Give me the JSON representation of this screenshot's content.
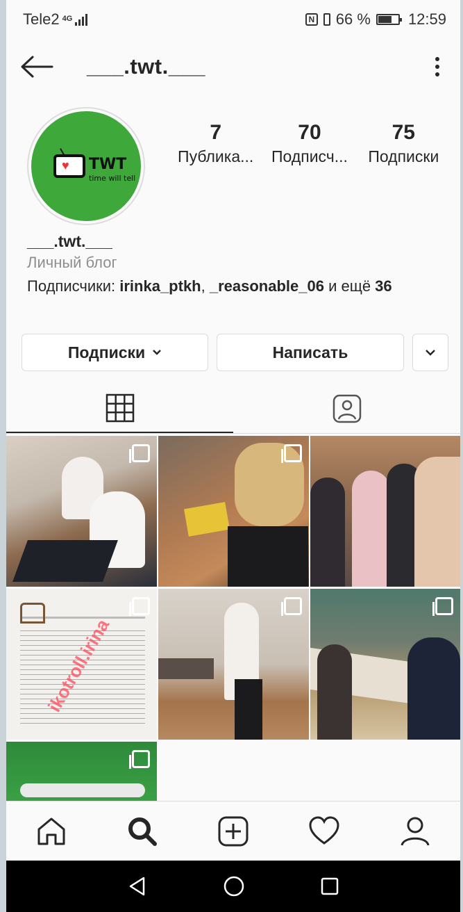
{
  "status": {
    "carrier": "Tele2",
    "network": "4G",
    "battery": "66 %",
    "time": "12:59"
  },
  "header": {
    "username": "___.twt.___"
  },
  "avatar": {
    "logo_text": "TWT",
    "logo_tagline": "time will tell"
  },
  "stats": [
    {
      "num": "7",
      "label": "Публика..."
    },
    {
      "num": "70",
      "label": "Подписч..."
    },
    {
      "num": "75",
      "label": "Подписки"
    }
  ],
  "bio": {
    "name": "___.twt.___",
    "category": "Личный блог",
    "followed_prefix": "Подписчики: ",
    "user1": "irinka_ptkh",
    "sep": ", ",
    "user2": "_reasonable_06",
    "suffix": " и ещё ",
    "count": "36"
  },
  "actions": {
    "follow_label": "Подписки",
    "message_label": "Написать"
  },
  "grid": {
    "watermark": "ikotroll.irina"
  },
  "colors": {
    "avatar_green": "#3fa83a",
    "accent": "#262626"
  }
}
